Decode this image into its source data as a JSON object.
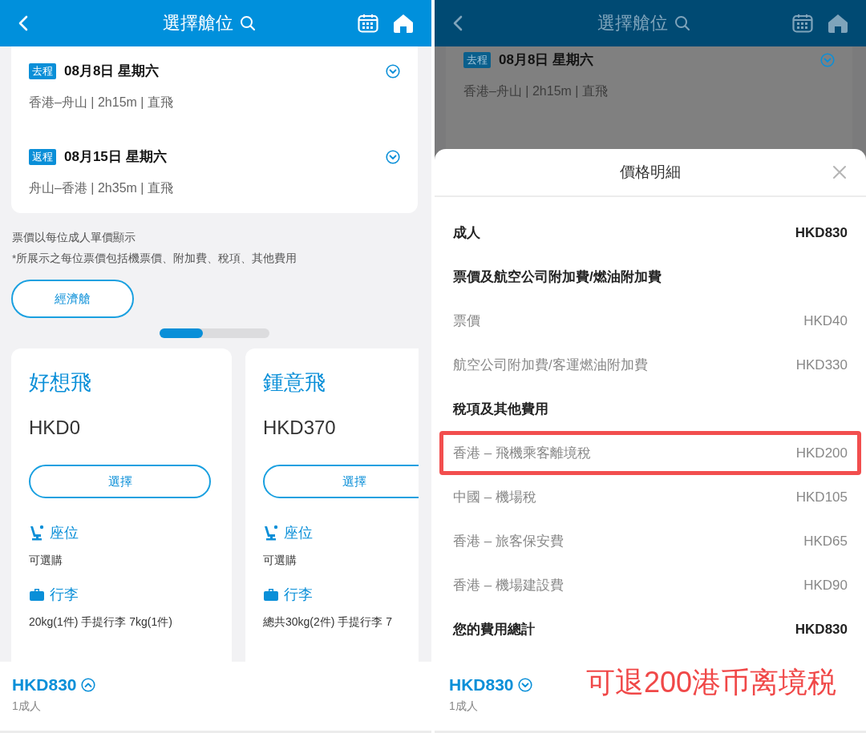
{
  "screens": [
    {
      "dimmed": false,
      "header": {
        "title": "選擇艙位"
      },
      "trips": [
        {
          "badge": "去程",
          "date": "08月8日 星期六",
          "route": "香港–舟山 | 2h15m | 直飛"
        },
        {
          "badge": "返程",
          "date": "08月15日 星期六",
          "route": "舟山–香港 | 2h35m | 直飛"
        }
      ],
      "notes": [
        "票價以每位成人單價顯示",
        "*所展示之每位票價包括機票價、附加費、稅項、其他費用"
      ],
      "cabin_tab": "經濟艙",
      "carousel": {
        "level": 0.4
      },
      "fares": [
        {
          "name": "好想飛",
          "price": "HKD0",
          "button": "選擇",
          "seat_label": "座位",
          "seat_text": "可選購",
          "baggage_label": "行李",
          "baggage_text": "20kg(1件) 手提行李 7kg(1件)"
        },
        {
          "name": "鍾意飛",
          "price": "HKD370",
          "button": "選擇",
          "seat_label": "座位",
          "seat_text": "可選購",
          "baggage_label": "行李",
          "baggage_text": "總共30kg(2件) 手提行李 7"
        }
      ],
      "footer": {
        "price": "HKD830",
        "passengers": "1成人",
        "expanded": false
      }
    },
    {
      "dimmed": true,
      "header": {
        "title": "選擇艙位"
      },
      "trips": [
        {
          "badge": "去程",
          "date": "08月8日 星期六",
          "route": "香港–舟山 | 2h15m | 直飛"
        }
      ],
      "price_sheet": {
        "title": "價格明細",
        "rows": [
          {
            "kind": "total",
            "label": "成人",
            "amount": "HKD830"
          },
          {
            "kind": "heading",
            "label": "票價及航空公司附加費/燃油附加費"
          },
          {
            "kind": "item",
            "label": "票價",
            "amount": "HKD40",
            "highlighted": false
          },
          {
            "kind": "item",
            "label": "航空公司附加費/客運燃油附加費",
            "amount": "HKD330",
            "highlighted": false
          },
          {
            "kind": "heading",
            "label": "稅項及其他費用"
          },
          {
            "kind": "item",
            "label": "香港 – 飛機乘客離境稅",
            "amount": "HKD200",
            "highlighted": true
          },
          {
            "kind": "item",
            "label": "中國 – 機場稅",
            "amount": "HKD105",
            "highlighted": false
          },
          {
            "kind": "item",
            "label": "香港 – 旅客保安費",
            "amount": "HKD65",
            "highlighted": false
          },
          {
            "kind": "item",
            "label": "香港 – 機場建設費",
            "amount": "HKD90",
            "highlighted": false
          },
          {
            "kind": "total",
            "label": "您的費用總計",
            "amount": "HKD830"
          }
        ]
      },
      "footer": {
        "price": "HKD830",
        "passengers": "1成人",
        "expanded": true
      },
      "annotation": "可退200港币离境税"
    }
  ]
}
